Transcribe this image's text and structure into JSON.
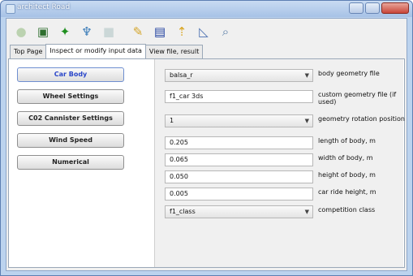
{
  "window": {
    "title": "architect Road"
  },
  "toolbar": {
    "icons": [
      "sphere-icon",
      "window-icon",
      "runner-icon",
      "tree-icon",
      "blank-icon",
      "edit-icon",
      "save-icon",
      "export-icon",
      "chart-icon",
      "zoom-icon"
    ]
  },
  "tabs": [
    {
      "label": "Top Page"
    },
    {
      "label": "Inspect or modify input data"
    },
    {
      "label": "View file, result"
    }
  ],
  "nav": [
    {
      "label": "Car Body"
    },
    {
      "label": "Wheel Settings"
    },
    {
      "label": "C02 Cannister Settings"
    },
    {
      "label": "Wind Speed"
    },
    {
      "label": "Numerical"
    }
  ],
  "form": {
    "body_geometry_file": {
      "value": "balsa_r",
      "label": "body geometry file"
    },
    "custom_geometry_file": {
      "value": "f1_car 3ds",
      "label": "custom geometry file (if used)"
    },
    "geometry_rotation": {
      "value": "1",
      "label": "geometry rotation position"
    },
    "length": {
      "value": "0.205",
      "label": "length of body, m"
    },
    "width": {
      "value": "0.065",
      "label": "width of body, m"
    },
    "height": {
      "value": "0.050",
      "label": "height of body, m"
    },
    "ride_height": {
      "value": "0.005",
      "label": "car ride height, m"
    },
    "competition_class": {
      "value": "f1_class",
      "label": "competition class"
    }
  }
}
